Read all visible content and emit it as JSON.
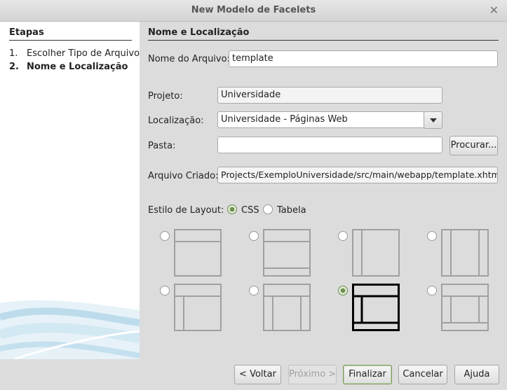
{
  "window": {
    "title": "New Modelo de Facelets"
  },
  "sidebar": {
    "title": "Etapas",
    "steps": [
      {
        "number": "1.",
        "label": "Escolher Tipo de Arquivo"
      },
      {
        "number": "2.",
        "label": "Nome e Localização"
      }
    ]
  },
  "main": {
    "title": "Nome e Localização",
    "file_name": {
      "label": "Nome do Arquivo:",
      "value": "template"
    },
    "project": {
      "label": "Projeto:",
      "value": "Universidade"
    },
    "location": {
      "label": "Localização:",
      "value": "Universidade - Páginas Web"
    },
    "folder": {
      "label": "Pasta:",
      "value": "",
      "browse_label": "Procurar..."
    },
    "created_file": {
      "label": "Arquivo Criado:",
      "value": "Projects/ExemploUniversidade/src/main/webapp/template.xhtml"
    },
    "layout_style": {
      "label": "Estilo de Layout:",
      "options": [
        "CSS",
        "Tabela"
      ],
      "selected": "CSS"
    },
    "layout_templates_selected": 7
  },
  "buttons": {
    "back": "< Voltar",
    "next": "Próximo >",
    "finish": "Finalizar",
    "cancel": "Cancelar",
    "help": "Ajuda"
  }
}
